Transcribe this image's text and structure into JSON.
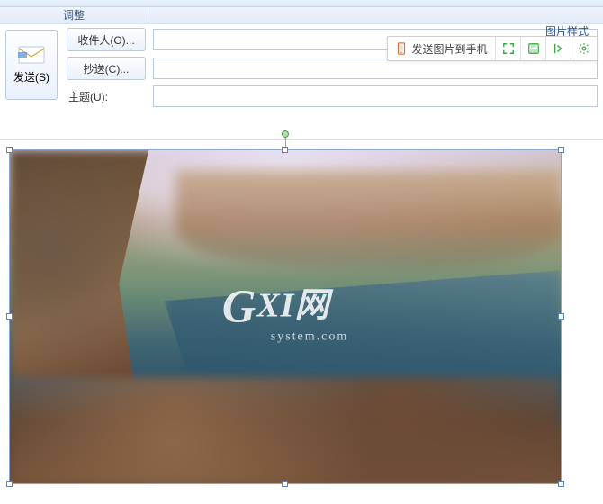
{
  "ribbon": {
    "adjust_group_label": "调整",
    "picture_style_tab": "图片样式"
  },
  "toolbar": {
    "send_to_phone": "发送图片到手机"
  },
  "compose": {
    "send_button": "发送(S)",
    "to_button": "收件人(O)...",
    "cc_button": "抄送(C)...",
    "subject_label": "主题(U):",
    "to_value": "",
    "cc_value": "",
    "subject_value": ""
  },
  "watermark": {
    "line1_prefix": "G",
    "line1_rest": "XI网",
    "line2": "system.com"
  }
}
